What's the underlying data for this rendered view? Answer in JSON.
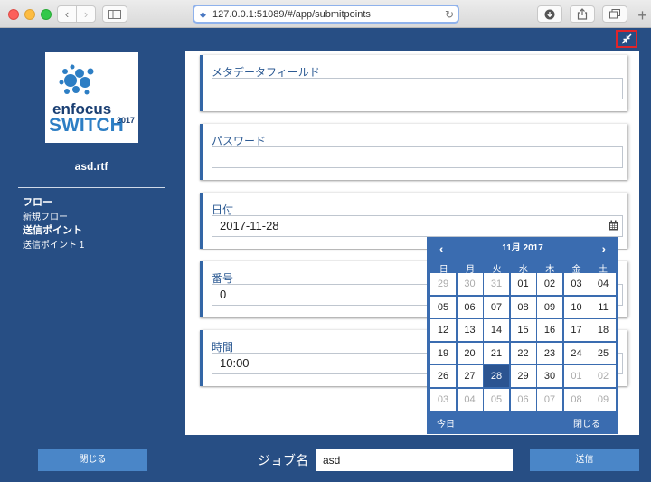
{
  "browser": {
    "url": "127.0.0.1:51089/#/app/submitpoints"
  },
  "left_panel": {
    "logo_top": "enfocus",
    "logo_bottom": "SWITCH",
    "logo_year": "2017",
    "filename": "asd.rtf",
    "flow_label": "フロー",
    "flow_value": "新規フロー",
    "submit_point_label": "送信ポイント",
    "submit_point_value": "送信ポイント 1"
  },
  "form": {
    "fields": [
      {
        "label": "メタデータフィールド",
        "value": ""
      },
      {
        "label": "パスワード",
        "value": ""
      },
      {
        "label": "日付",
        "value": "2017-11-28"
      },
      {
        "label": "番号",
        "value": "0"
      },
      {
        "label": "時間",
        "value": "10:00"
      }
    ]
  },
  "datepicker": {
    "title": "11月 2017",
    "weekdays": [
      "日",
      "月",
      "火",
      "水",
      "木",
      "金",
      "土"
    ],
    "days": [
      [
        "29",
        "30",
        "31",
        "01",
        "02",
        "03",
        "04"
      ],
      [
        "05",
        "06",
        "07",
        "08",
        "09",
        "10",
        "11"
      ],
      [
        "12",
        "13",
        "14",
        "15",
        "16",
        "17",
        "18"
      ],
      [
        "19",
        "20",
        "21",
        "22",
        "23",
        "24",
        "25"
      ],
      [
        "26",
        "27",
        "28",
        "29",
        "30",
        "01",
        "02"
      ],
      [
        "03",
        "04",
        "05",
        "06",
        "07",
        "08",
        "09"
      ]
    ],
    "selected": "28",
    "today_label": "今日",
    "close_label": "閉じる"
  },
  "footer": {
    "close_button": "閉じる",
    "job_name_label": "ジョブ名",
    "job_name_value": "asd",
    "send_button": "送信"
  },
  "colors": {
    "background": "#274e84",
    "accent": "#3a6cb0",
    "button": "#4a86c8",
    "selected_day": "#2b5491"
  }
}
